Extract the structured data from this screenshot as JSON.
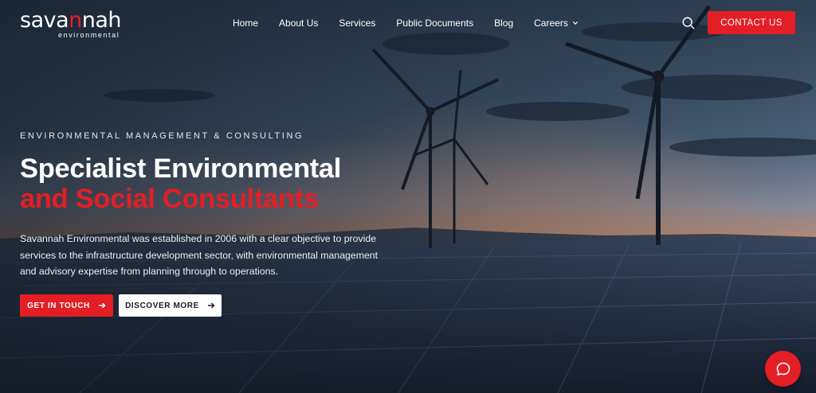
{
  "brand": {
    "logo_main_pre": "sava",
    "logo_main_red": "n",
    "logo_main_post": "nah",
    "logo_sub": "environmental",
    "accent_color": "#e31e24"
  },
  "nav": {
    "items": [
      {
        "label": "Home"
      },
      {
        "label": "About Us"
      },
      {
        "label": "Services"
      },
      {
        "label": "Public Documents"
      },
      {
        "label": "Blog"
      },
      {
        "label": "Careers"
      }
    ],
    "search_icon": "search-icon",
    "contact_label": "CONTACT US"
  },
  "hero": {
    "eyebrow": "ENVIRONMENTAL MANAGEMENT & CONSULTING",
    "headline_line1": "Specialist Environmental",
    "headline_line2": "and Social Consultants",
    "description": "Savannah Environmental was established in 2006 with a clear objective to provide services to the infrastructure development sector, with environmental management and advisory expertise from planning through to operations.",
    "primary_button": "GET IN TOUCH",
    "secondary_button": "DISCOVER MORE"
  },
  "chat": {
    "icon": "chat-bubble-icon"
  }
}
